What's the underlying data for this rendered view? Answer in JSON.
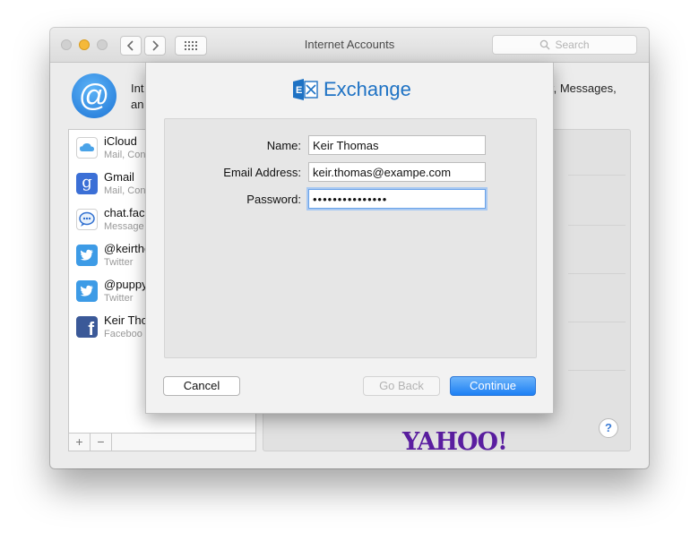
{
  "window": {
    "title": "Internet Accounts"
  },
  "search": {
    "placeholder": "Search"
  },
  "intro": {
    "left_text": "Int",
    "left_text_2": "an",
    "right_text": "r, Messages,"
  },
  "accounts": [
    {
      "name": "iCloud",
      "sub": "Mail, Con",
      "icon": "icloud-icon",
      "color": "#4aa3e8"
    },
    {
      "name": "Gmail",
      "sub": "Mail, Con",
      "icon": "google-icon",
      "color": "#3b6fd6"
    },
    {
      "name": "chat.fac",
      "sub": "Message",
      "icon": "chat-icon",
      "color": "#2f6fd0"
    },
    {
      "name": "@keirthe",
      "sub": "Twitter",
      "icon": "twitter-icon",
      "color": "#3d9be6"
    },
    {
      "name": "@puppy",
      "sub": "Twitter",
      "icon": "twitter-icon",
      "color": "#3d9be6"
    },
    {
      "name": "Keir Tho",
      "sub": "Faceboo",
      "icon": "facebook-icon",
      "color": "#3b5998"
    }
  ],
  "sidebar_footer": {
    "add": "+",
    "remove": "−"
  },
  "providers": {
    "yahoo": "YAHOO!"
  },
  "help": {
    "label": "?"
  },
  "sheet": {
    "brand": "Exchange",
    "fields": {
      "name_label": "Name:",
      "name_value": "Keir Thomas",
      "email_label": "Email Address:",
      "email_value": "keir.thomas@exampe.com",
      "password_label": "Password:",
      "password_value": "•••••••••••••••"
    },
    "buttons": {
      "cancel": "Cancel",
      "back": "Go Back",
      "continue": "Continue"
    }
  }
}
